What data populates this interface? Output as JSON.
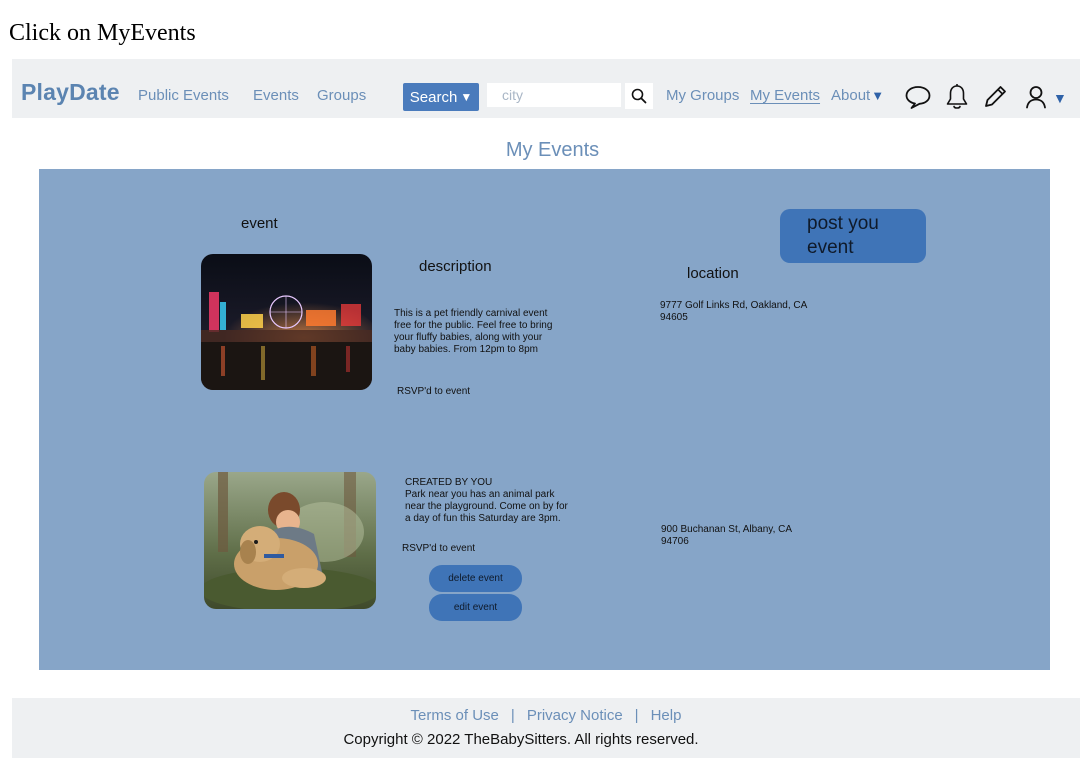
{
  "instruction": "Click on MyEvents",
  "nav": {
    "brand": "PlayDate",
    "links": [
      "Public Events",
      "Events",
      "Groups"
    ],
    "search_label": "Search",
    "search_caret": "▼",
    "city_placeholder": "city",
    "my_groups": "My Groups",
    "my_events": "My Events",
    "about": "About",
    "about_caret": "▼",
    "user_caret": "▼",
    "icons": [
      "search-icon",
      "chat-bubble-icon",
      "bell-icon",
      "pencil-icon",
      "user-icon"
    ]
  },
  "page_title": "My Events",
  "main": {
    "headers": {
      "event": "event",
      "description": "description",
      "location": "location"
    },
    "post_button": "post you event",
    "events": [
      {
        "image": "carnival-photo",
        "description": "This is a pet friendly carnival event free for the public. Feel free to bring your fluffy babies, along with your baby babies. From 12pm to 8pm",
        "status": "RSVP'd to event",
        "location": "9777 Golf Links Rd, Oakland, CA 94605"
      },
      {
        "image": "child-with-dog-photo",
        "created_by": "CREATED BY YOU",
        "description": "Park near you has an animal park near the playground. Come on by for a day of fun this Saturday are 3pm.",
        "status": "RSVP'd to event",
        "location": "900 Buchanan St, Albany, CA 94706",
        "delete_button": "delete event",
        "edit_button": "edit event"
      }
    ]
  },
  "footer": {
    "links": [
      "Terms of Use",
      "Privacy Notice",
      "Help"
    ],
    "copyright": "Copyright © 2022 TheBabySitters. All rights reserved."
  },
  "colors": {
    "brand": "#5b84b1",
    "link": "#6b8fb8",
    "button": "#4a7bbc",
    "panel": "#86a5c8",
    "bar": "#eef0f2"
  }
}
